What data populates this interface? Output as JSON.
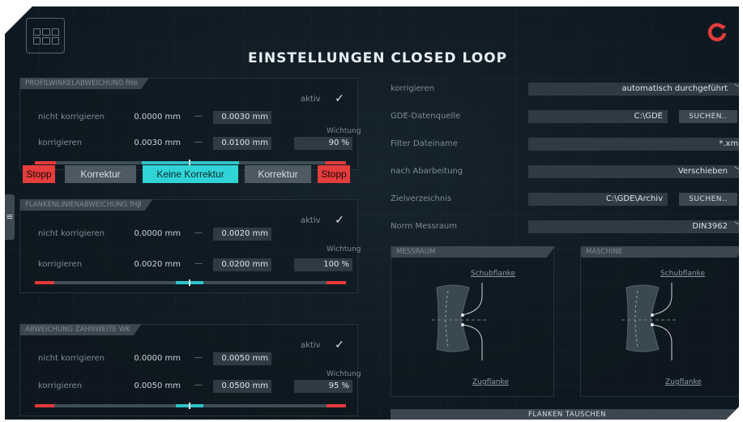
{
  "header": {
    "title": "EINSTELLUNGEN CLOSED LOOP",
    "app_icon": "grid-icon",
    "brand_icon": "brand-logo-icon",
    "brand_color": "#e23b3b"
  },
  "side_tab": {
    "icon": "menu-icon",
    "glyph": "≡"
  },
  "colors": {
    "accent": "#31d4d6",
    "danger": "#e53d3d",
    "field": "#2f3b44",
    "background": "#0f1a22"
  },
  "sections": [
    {
      "title": "PROFILWINKELABWEICHUNG fHα",
      "aktiv_label": "aktiv",
      "aktiv_checked": true,
      "row1": {
        "label": "nicht korrigieren",
        "from": "0.0000 mm",
        "dash": "—",
        "to": "0.0030 mm"
      },
      "row2": {
        "label": "korrigieren",
        "from": "0.0030 mm",
        "dash": "—",
        "to": "0.0100 mm"
      },
      "weight_label": "Wichtung",
      "weight": "90 %",
      "buttons": [
        "Stopp",
        "Korrektur",
        "Keine Korrektur",
        "Korrektur",
        "Stopp"
      ]
    },
    {
      "title": "FLANKENLINIENABWEICHUNG fHβ",
      "aktiv_label": "aktiv",
      "aktiv_checked": true,
      "row1": {
        "label": "nicht korrigieren",
        "from": "0.0000 mm",
        "dash": "—",
        "to": "0.0020 mm"
      },
      "row2": {
        "label": "korrigieren",
        "from": "0.0020 mm",
        "dash": "—",
        "to": "0.0200 mm"
      },
      "weight_label": "Wichtung",
      "weight": "100 %"
    },
    {
      "title": "ABWEICHUNG ZAHNWEITE WK",
      "aktiv_label": "aktiv",
      "aktiv_checked": true,
      "row1": {
        "label": "nicht korrigieren",
        "from": "0.0000 mm",
        "dash": "—",
        "to": "0.0050 mm"
      },
      "row2": {
        "label": "korrigieren",
        "from": "0.0050 mm",
        "dash": "—",
        "to": "0.0500 mm"
      },
      "weight_label": "Wichtung",
      "weight": "95 %"
    }
  ],
  "settings": {
    "korrigieren": {
      "label": "korrigieren",
      "value": "automatisch durchgeführt"
    },
    "gde_source": {
      "label": "GDE-Datenquelle",
      "value": "C:\\GDE",
      "button": "SUCHEN.."
    },
    "filter": {
      "label": "Filter Dateiname",
      "value": "*.xml"
    },
    "post": {
      "label": "nach Abarbeitung",
      "value": "Verschieben"
    },
    "target_dir": {
      "label": "Zielverzeichnis",
      "value": "C:\\GDE\\Archiv",
      "button": "SUCHEN.."
    },
    "norm": {
      "label": "Norm Messraum",
      "value": "DIN3962"
    }
  },
  "diagrams": {
    "messraum": {
      "title": "MESSRAUM",
      "top_label": "Schubflanke",
      "bottom_label": "Zugflanke"
    },
    "maschine": {
      "title": "MASCHINE",
      "top_label": "Schubflanke",
      "bottom_label": "Zugflanke"
    }
  },
  "swap_button": "FLANKEN TAUSCHEN"
}
